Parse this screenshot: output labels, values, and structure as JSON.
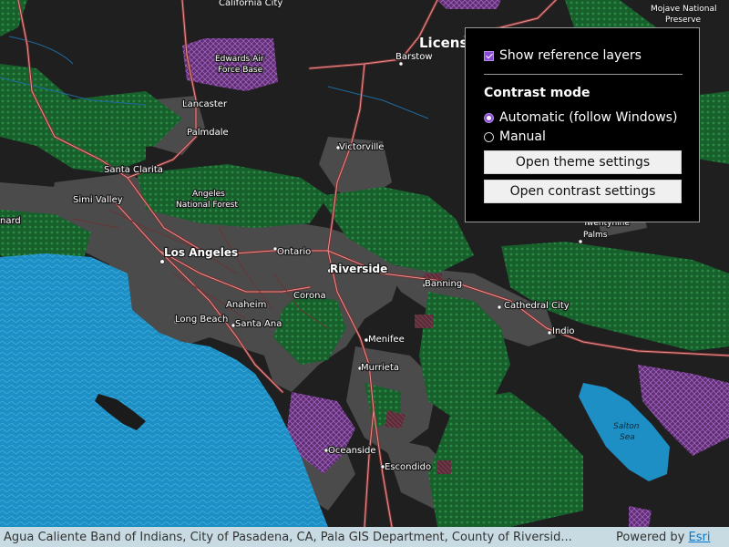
{
  "map": {
    "labels": {
      "california_city": "California City",
      "mojave_preserve": "Mojave National Preserve",
      "edwards": "Edwards Air Force Base",
      "barstow": "Barstow",
      "license": "Licens",
      "lancaster": "Lancaster",
      "palmdale": "Palmdale",
      "victorville": "Victorville",
      "santa_clarita": "Santa Clarita",
      "simi_valley": "Simi Valley",
      "angeles": "Angeles National Forest",
      "nard": "nard",
      "twentynine": "Twentynine Palms",
      "los_angeles": "Los Angeles",
      "ontario": "Ontario",
      "riverside": "Riverside",
      "banning": "Banning",
      "anaheim": "Anaheim",
      "corona": "Corona",
      "cathedral_city": "Cathedral City",
      "long_beach": "Long Beach",
      "santa_ana": "Santa Ana",
      "indio": "Indio",
      "menifee": "Menifee",
      "murrieta": "Murrieta",
      "salton_sea": "Salton Sea",
      "oceanside": "Oceanside",
      "escondido": "Escondido"
    }
  },
  "panel": {
    "show_reference_layers": "Show reference layers",
    "contrast_mode_heading": "Contrast mode",
    "radio_automatic": "Automatic (follow Windows)",
    "radio_manual": "Manual",
    "selected_mode": "Automatic (follow Windows)",
    "open_theme_button": "Open theme settings",
    "open_contrast_button": "Open contrast settings"
  },
  "attribution": {
    "sources": "Agua Caliente Band of Indians, City of Pasadena, CA, Pala GIS Department, County of Riversid...",
    "powered_by": "Powered by ",
    "esri": "Esri"
  },
  "colors": {
    "background": "#1e1e1e",
    "ocean": "#1f93c8",
    "forest": "#1d6b33",
    "urban": "#4a4a4a",
    "restricted": "#6f3b80",
    "roads": "#c86464",
    "accent": "#8a4bd6"
  }
}
